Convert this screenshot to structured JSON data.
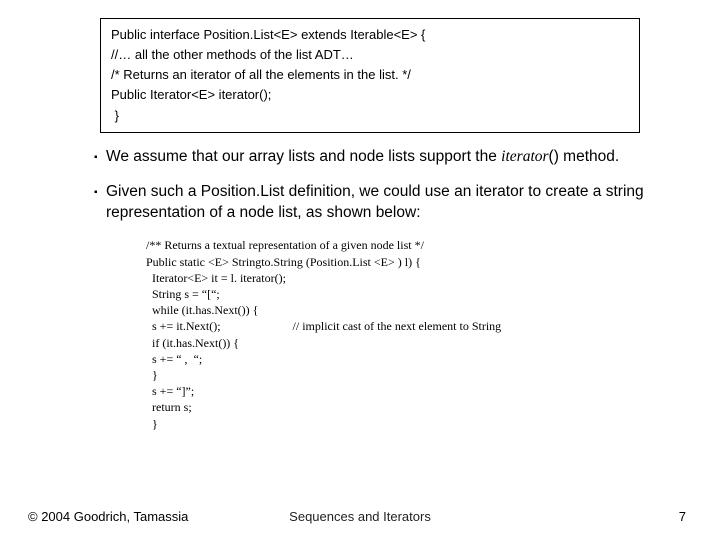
{
  "codebox": {
    "l1a": "Public interface ",
    "l1b": "Position.List<E>",
    "l1c": " extends ",
    "l1d": "Iterable<E> {",
    "l2": "//… all the other methods of the list ADT…",
    "l3": "/* Returns an iterator of all the elements in the list. */",
    "l4a": "Public ",
    "l4b": "Iterator<E> iterator();",
    "l5": " }"
  },
  "bullet1": {
    "pre": "We assume that our array lists and node lists support the ",
    "it": "iterator",
    "post": "() method."
  },
  "bullet2": {
    "text": "Given such a Position.List definition, we could use an iterator to create a string representation of a node list, as shown below:"
  },
  "code": {
    "c1": "/** Returns a textual representation of a given node list */",
    "c2": "Public static <E> Stringto.String (Position.List <E> ) l) {",
    "c3": "  Iterator<E> it = l. iterator();",
    "c4": "  String s = “[“;",
    "c5": "  while (it.has.Next()) {",
    "c6a": "  s += it.Next();",
    "c6b": "// implicit cast of the next element to String",
    "c7": "  if (it.has.Next()) {",
    "c8": "  s += “ ,  “;",
    "c9": "  }",
    "c10": "  s += “]”;",
    "c11": "  return s;",
    "c12": "  }"
  },
  "footer": {
    "copyright": "© 2004 Goodrich, Tamassia",
    "center": "Sequences and Iterators",
    "page": "7"
  }
}
